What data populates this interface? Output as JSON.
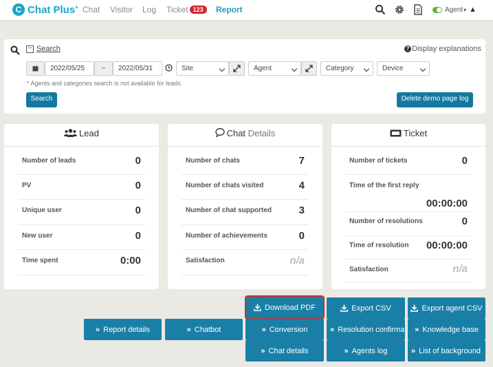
{
  "app": {
    "name": "Chat Plus",
    "logo_mark": "C",
    "logo_sup": "+"
  },
  "nav": {
    "items": [
      "Chat",
      "Visitor",
      "Log",
      "Ticket",
      "Report"
    ],
    "ticket_badge": "123",
    "active": "Report"
  },
  "topbar": {
    "agent_label": "Agent",
    "agent_caret": "▾",
    "warning_glyph": "▲"
  },
  "search": {
    "title": "Search",
    "toggle_glyph": "−",
    "explain_icon_glyph": "?",
    "explanations_label": "Display explanations",
    "date_from": "2022/05/25",
    "date_sep": "~",
    "date_to": "2022/05/31",
    "site_placeholder": "Site",
    "agent_placeholder": "Agent",
    "category_placeholder": "Category",
    "device_placeholder": "Device",
    "note": "* Agents and categories search is not available for leads.",
    "search_button": "Search",
    "delete_button": "Delete demo page log"
  },
  "cards": {
    "lead": {
      "title": "Lead",
      "rows": [
        {
          "label": "Number of leads",
          "value": "0"
        },
        {
          "label": "PV",
          "value": "0"
        },
        {
          "label": "Unique user",
          "value": "0"
        },
        {
          "label": "New user",
          "value": "0"
        },
        {
          "label": "Time spent",
          "value": "0:00"
        }
      ]
    },
    "chat": {
      "title_main": "Chat",
      "title_sub": "Details",
      "rows": [
        {
          "label": "Number of chats",
          "value": "7"
        },
        {
          "label": "Number of chats visited",
          "value": "4"
        },
        {
          "label": "Number of chat supported",
          "value": "3"
        },
        {
          "label": "Number of achievements",
          "value": "0"
        },
        {
          "label": "Satisfaction",
          "value": "n/a"
        }
      ]
    },
    "ticket": {
      "title": "Ticket",
      "rows": [
        {
          "label": "Number of tickets",
          "value": "0"
        },
        {
          "label": "Time of the first reply",
          "value": "00:00:00"
        },
        {
          "label": "Number of resolutions",
          "value": "0"
        },
        {
          "label": "Time of resolution",
          "value": "00:00:00"
        },
        {
          "label": "Satisfaction",
          "value": "n/a"
        }
      ]
    }
  },
  "actions": {
    "download_pdf": "Download PDF",
    "export_csv": "Export CSV",
    "export_agent_csv": "Export agent CSV",
    "report_details": "Report details",
    "chatbot": "Chatbot",
    "conversion": "Conversion",
    "resolution_confirm": "Resolution confirma",
    "knowledge_base": "Knowledge base",
    "chat_details": "Chat details",
    "agents_log": "Agents log",
    "list_of_background": "List of background"
  },
  "colors": {
    "accent": "#1aa6c4",
    "button": "#1a7fa6",
    "badge": "#d3262e",
    "highlight": "#d32a2a"
  }
}
